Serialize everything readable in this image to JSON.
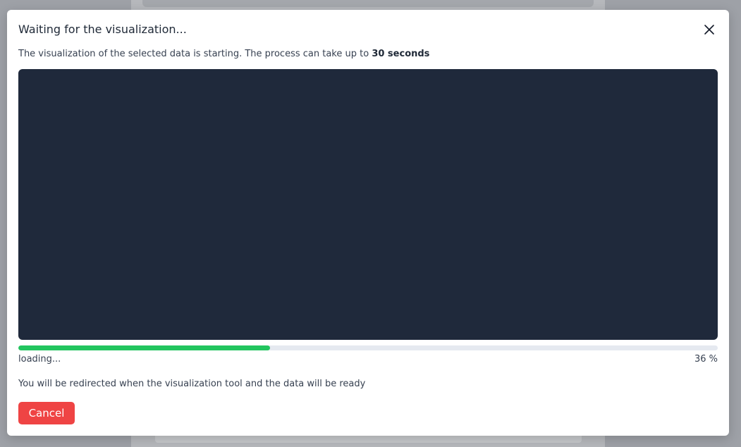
{
  "modal": {
    "title": "Waiting for the visualization...",
    "description_prefix": "The visualization of the selected data is starting. The process can take up to ",
    "description_emphasis": "30 seconds",
    "progress": {
      "percent": 36,
      "status_text": "loading...",
      "percent_text": "36 %",
      "fill_color": "#22c55e",
      "track_color": "#e5e9f0"
    },
    "redirect_note": "You will be redirected when the visualization tool and the data will be ready",
    "cancel_label": "Cancel",
    "close_icon": "close-icon"
  },
  "colors": {
    "viz_background": "#1f293b",
    "cancel_button": "#ef4444"
  }
}
